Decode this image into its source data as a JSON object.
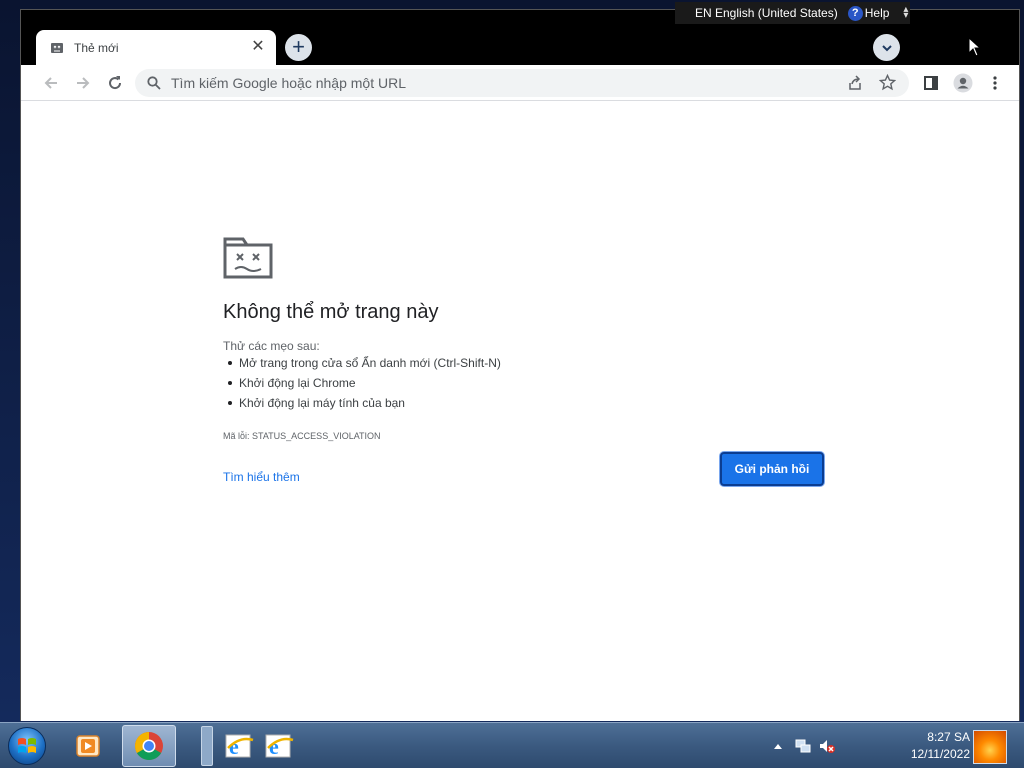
{
  "language_bar": {
    "language": "EN English (United States)",
    "help_label": "Help"
  },
  "browser": {
    "tab": {
      "title": "Thẻ mới",
      "close_glyph": "✕"
    },
    "new_tab_glyph": "+",
    "omnibox": {
      "placeholder": "Tìm kiếm Google hoặc nhập một URL",
      "value": ""
    }
  },
  "error_page": {
    "heading": "Không thể mở trang này",
    "tips_intro": "Thử các mẹo sau:",
    "tips": [
      "Mở trang trong cửa sổ Ẩn danh mới (Ctrl-Shift-N)",
      "Khởi động lại Chrome",
      "Khởi động lại máy tính của bạn"
    ],
    "error_code": "Mã lỗi: STATUS_ACCESS_VIOLATION",
    "learn_more": "Tìm hiểu thêm",
    "feedback_button": "Gửi phản hồi"
  },
  "taskbar": {
    "time": "8:27 SA",
    "date": "12/11/2022",
    "apps": [
      "media-player-icon",
      "chrome-icon",
      "internet-explorer-icon",
      "internet-explorer-icon"
    ]
  },
  "colors": {
    "accent": "#1a73e8",
    "taskbar": "#3b5a80",
    "heading_text": "#202124"
  }
}
